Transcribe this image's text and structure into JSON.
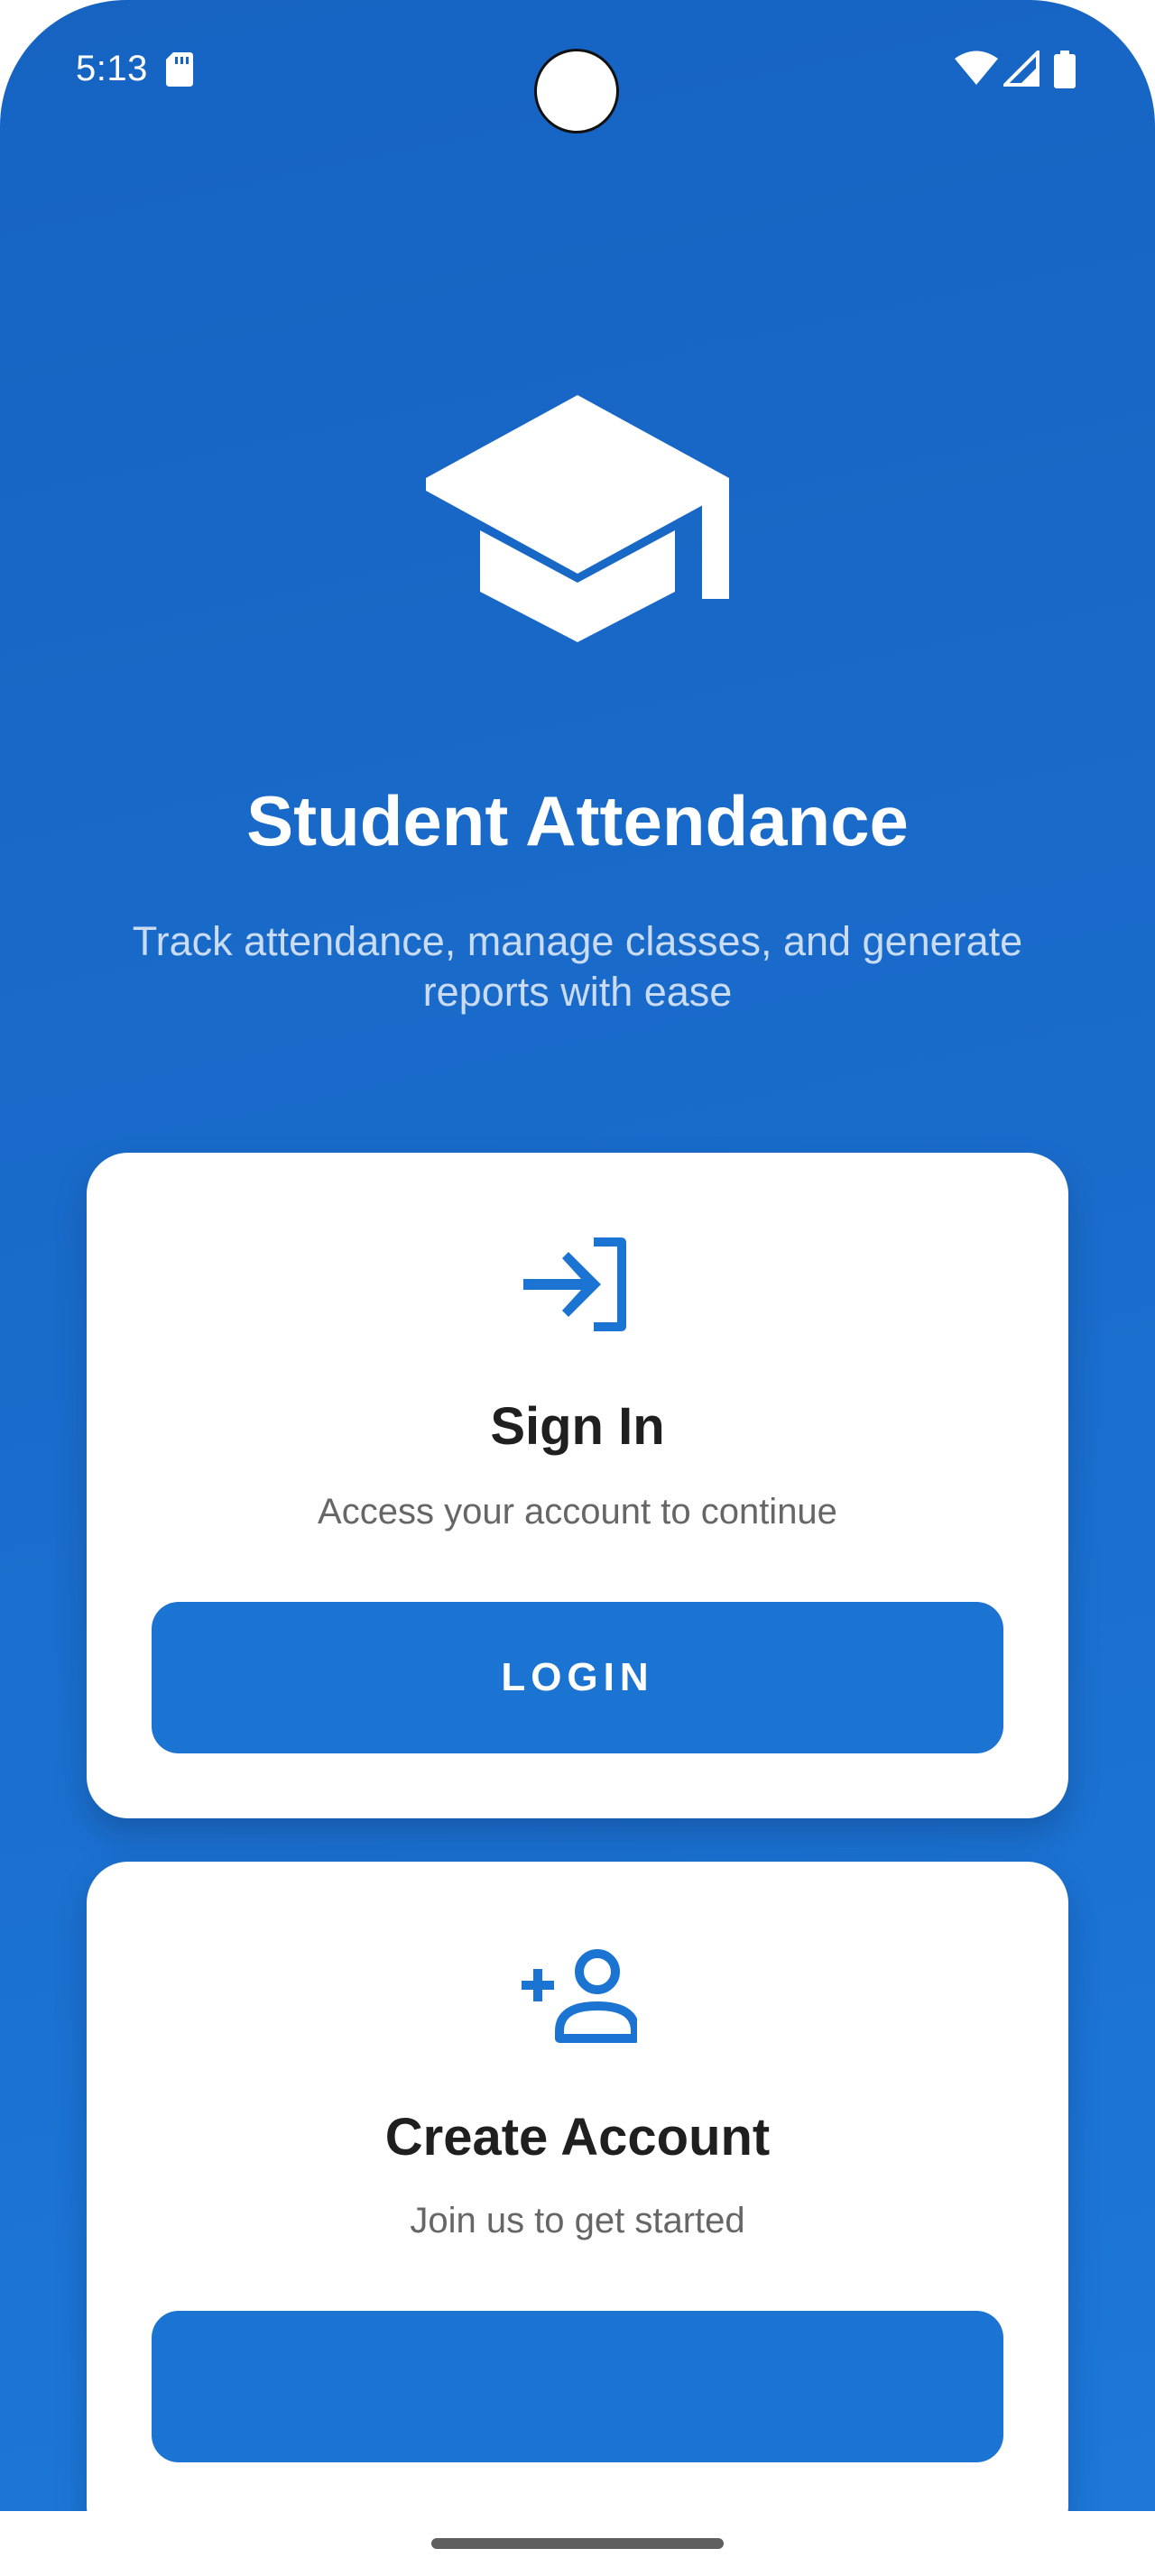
{
  "status_bar": {
    "time": "5:13",
    "icons": [
      "sd-card-icon",
      "wifi-icon",
      "cellular-signal-icon",
      "battery-icon"
    ]
  },
  "hero": {
    "icon": "graduation-cap-icon",
    "title": "Student Attendance",
    "subtitle": "Track attendance, manage classes, and generate reports with ease"
  },
  "signin_card": {
    "icon": "login-icon",
    "title": "Sign In",
    "description": "Access your account to continue",
    "button_label": "LOGIN"
  },
  "create_card": {
    "icon": "person-add-icon",
    "title": "Create Account",
    "description": "Join us to get started",
    "button_label": ""
  },
  "colors": {
    "background_primary": "#1663c2",
    "background_secondary": "#1d78d8",
    "accent": "#1c74d2",
    "card_background": "#ffffff",
    "title_text": "#1f1f1f",
    "secondary_text": "#666666",
    "subtitle_text": "#c9dcf4"
  }
}
